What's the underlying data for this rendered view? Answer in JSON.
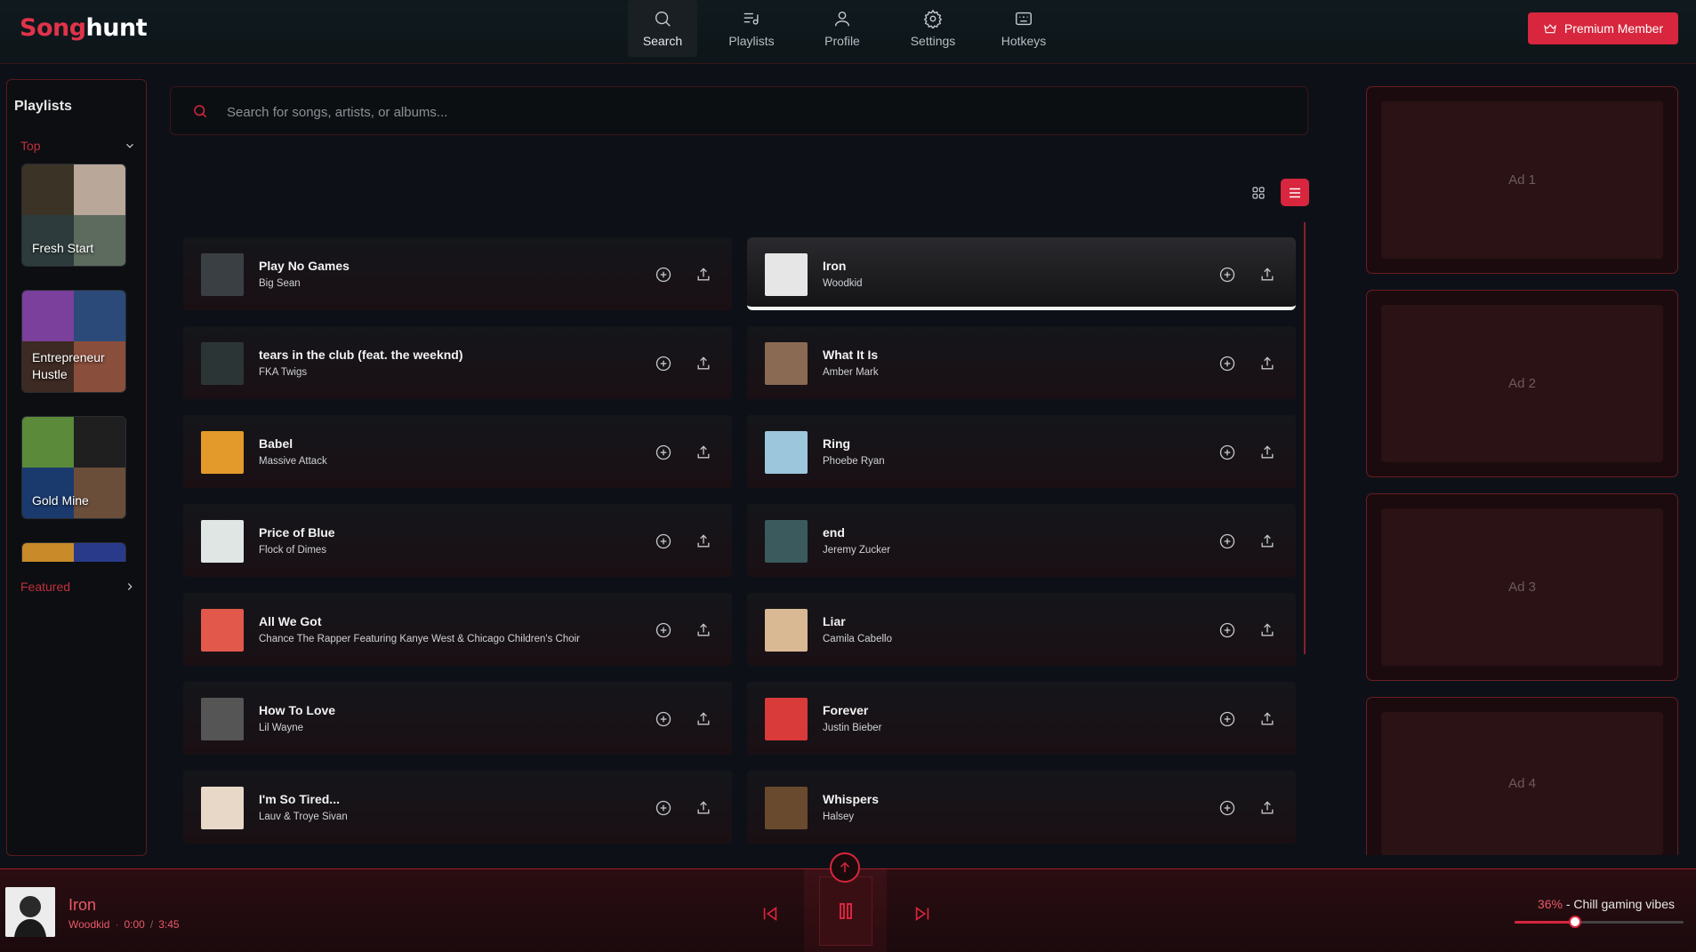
{
  "app": {
    "logo_part1": "Song",
    "logo_part2": "hunt"
  },
  "nav": [
    {
      "label": "Search",
      "icon": "search-icon"
    },
    {
      "label": "Playlists",
      "icon": "playlist-icon"
    },
    {
      "label": "Profile",
      "icon": "user-icon"
    },
    {
      "label": "Settings",
      "icon": "gear-icon"
    },
    {
      "label": "Hotkeys",
      "icon": "keyboard-icon"
    }
  ],
  "premium_label": "Premium Member",
  "sidebar": {
    "title": "Playlists",
    "top_label": "Top",
    "featured_label": "Featured",
    "playlists": [
      {
        "label": "Fresh Start",
        "colors": [
          "#3a3326",
          "#b9a79a",
          "#2e3b3c",
          "#5d6a5e"
        ]
      },
      {
        "label": "Entrepreneur Hustle",
        "colors": [
          "#7b3f9c",
          "#2b4a7a",
          "#3d2a22",
          "#8a4e3c"
        ]
      },
      {
        "label": "Gold Mine",
        "colors": [
          "#5a8a3a",
          "#1f1f1f",
          "#1a3a6e",
          "#6a4e3a"
        ]
      },
      {
        "label": "",
        "colors": [
          "#c98a2a",
          "#2a3a8a",
          "#1a1a1a",
          "#1a1a1a"
        ]
      }
    ]
  },
  "search": {
    "placeholder": "Search for songs, artists, or albums..."
  },
  "songs": [
    {
      "title": "Play No Games",
      "artist": "Big Sean",
      "art": "#3a3f44"
    },
    {
      "title": "Iron",
      "artist": "Woodkid",
      "art": "#e6e6e6",
      "selected": true
    },
    {
      "title": "tears in the club (feat. the weeknd)",
      "artist": "FKA Twigs",
      "art": "#2c3535"
    },
    {
      "title": "What It Is",
      "artist": "Amber Mark",
      "art": "#8a6a52"
    },
    {
      "title": "Babel",
      "artist": "Massive Attack",
      "art": "#e39a2a"
    },
    {
      "title": "Ring",
      "artist": "Phoebe Ryan",
      "art": "#9cc6dc"
    },
    {
      "title": "Price of Blue",
      "artist": "Flock of Dimes",
      "art": "#dfe6e4"
    },
    {
      "title": "end",
      "artist": "Jeremy Zucker",
      "art": "#3a5a5e"
    },
    {
      "title": "All We Got",
      "artist": "Chance The Rapper Featuring Kanye West & Chicago Children's Choir",
      "art": "#e2584a"
    },
    {
      "title": "Liar",
      "artist": "Camila Cabello",
      "art": "#d9b994"
    },
    {
      "title": "How To Love",
      "artist": "Lil Wayne",
      "art": "#555555"
    },
    {
      "title": "Forever",
      "artist": "Justin Bieber",
      "art": "#d93a3a"
    },
    {
      "title": "I'm So Tired...",
      "artist": "Lauv & Troye Sivan",
      "art": "#e8d8c8"
    },
    {
      "title": "Whispers",
      "artist": "Halsey",
      "art": "#6a4a2e"
    }
  ],
  "ads": [
    "Ad 1",
    "Ad 2",
    "Ad 3",
    "Ad 4"
  ],
  "player": {
    "title": "Iron",
    "artist": "Woodkid",
    "separator": "·",
    "current_time": "0:00",
    "time_separator": "/",
    "duration": "3:45",
    "volume_percent_label": "36%",
    "volume_text": " - Chill gaming vibes",
    "volume_fraction": 0.36
  },
  "colors": {
    "accent": "#d7263d",
    "background": "#0d1117"
  }
}
